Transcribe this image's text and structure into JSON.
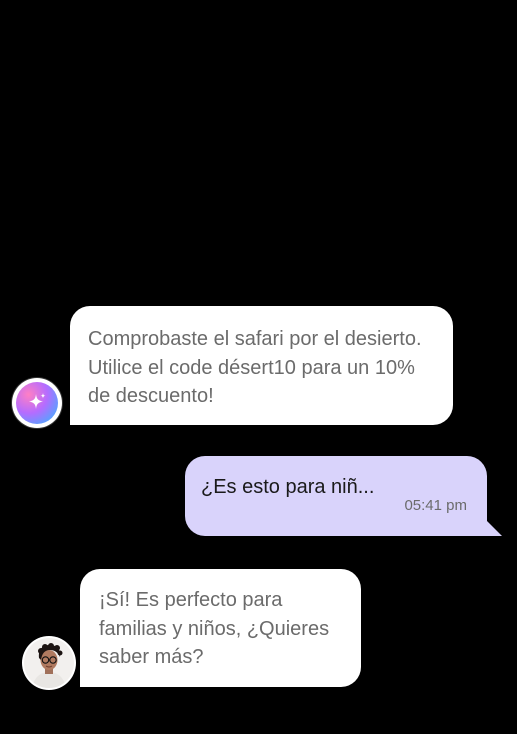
{
  "messages": [
    {
      "sender": "assistant",
      "avatar_icon": "sparkle-icon",
      "text": "Comprobaste el safari por el desierto. Utilice el code désert10 para un 10% de descuento!"
    },
    {
      "sender": "user",
      "text": "¿Es esto para niñ...",
      "time": "05:41 pm"
    },
    {
      "sender": "agent",
      "avatar_icon": "person-avatar",
      "text": "¡Sí! Es perfecto para familias y niños, ¿Quieres saber más?"
    }
  ],
  "colors": {
    "background": "#000000",
    "incoming_bubble": "#ffffff",
    "outgoing_bubble": "#d9d3fb",
    "incoming_text": "#6b6b6b",
    "outgoing_text": "#1a1a1a"
  }
}
